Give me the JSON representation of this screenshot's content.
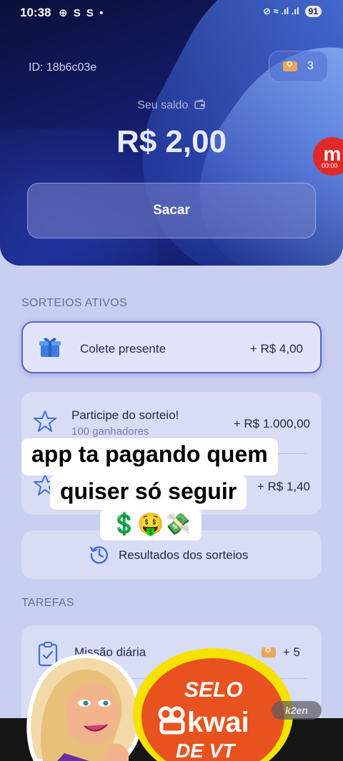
{
  "status_bar": {
    "time": "10:38",
    "notification_icons": "⊕ S S •",
    "network": "⊘ ≈ .ıl .ıl",
    "battery": "91"
  },
  "header": {
    "user_id": "ID: 18b6c03e",
    "tickets_count": "3",
    "balance_label": "Seu saldo",
    "balance_value": "R$ 2,00",
    "withdraw_label": "Sacar"
  },
  "recorder": {
    "letter": "m",
    "timer": "00:00"
  },
  "raffles": {
    "section_title": "SORTEIOS ATIVOS",
    "gift": {
      "label": "Colete presente",
      "amount": "+ R$ 4,00"
    },
    "items": [
      {
        "title": "Participe do sorteio!",
        "subtitle": "100 ganhadores",
        "amount": "+ R$ 1.000,00"
      },
      {
        "title": "",
        "subtitle": "",
        "amount": "+ R$ 1,40"
      }
    ],
    "results_label": "Resultados dos sorteios"
  },
  "tasks": {
    "section_title": "TAREFAS",
    "items": [
      {
        "label": "Missão diária",
        "reward": "+ 5"
      }
    ]
  },
  "overlay": {
    "caption_line1": "app ta pagando quem",
    "caption_line2": "quiser só seguir",
    "emojis": "💲🤑💸",
    "badge_line1": "SELO",
    "badge_line2": "kwai",
    "badge_line3": "DE VT",
    "watermark": "k2en"
  },
  "colors": {
    "accent": "#5664c9",
    "header_bg": "#141d6b",
    "background": "#c9cff0",
    "ticket": "#e9a65a",
    "kwai_orange": "#e8521f",
    "sticker_yellow": "#f6e200"
  }
}
